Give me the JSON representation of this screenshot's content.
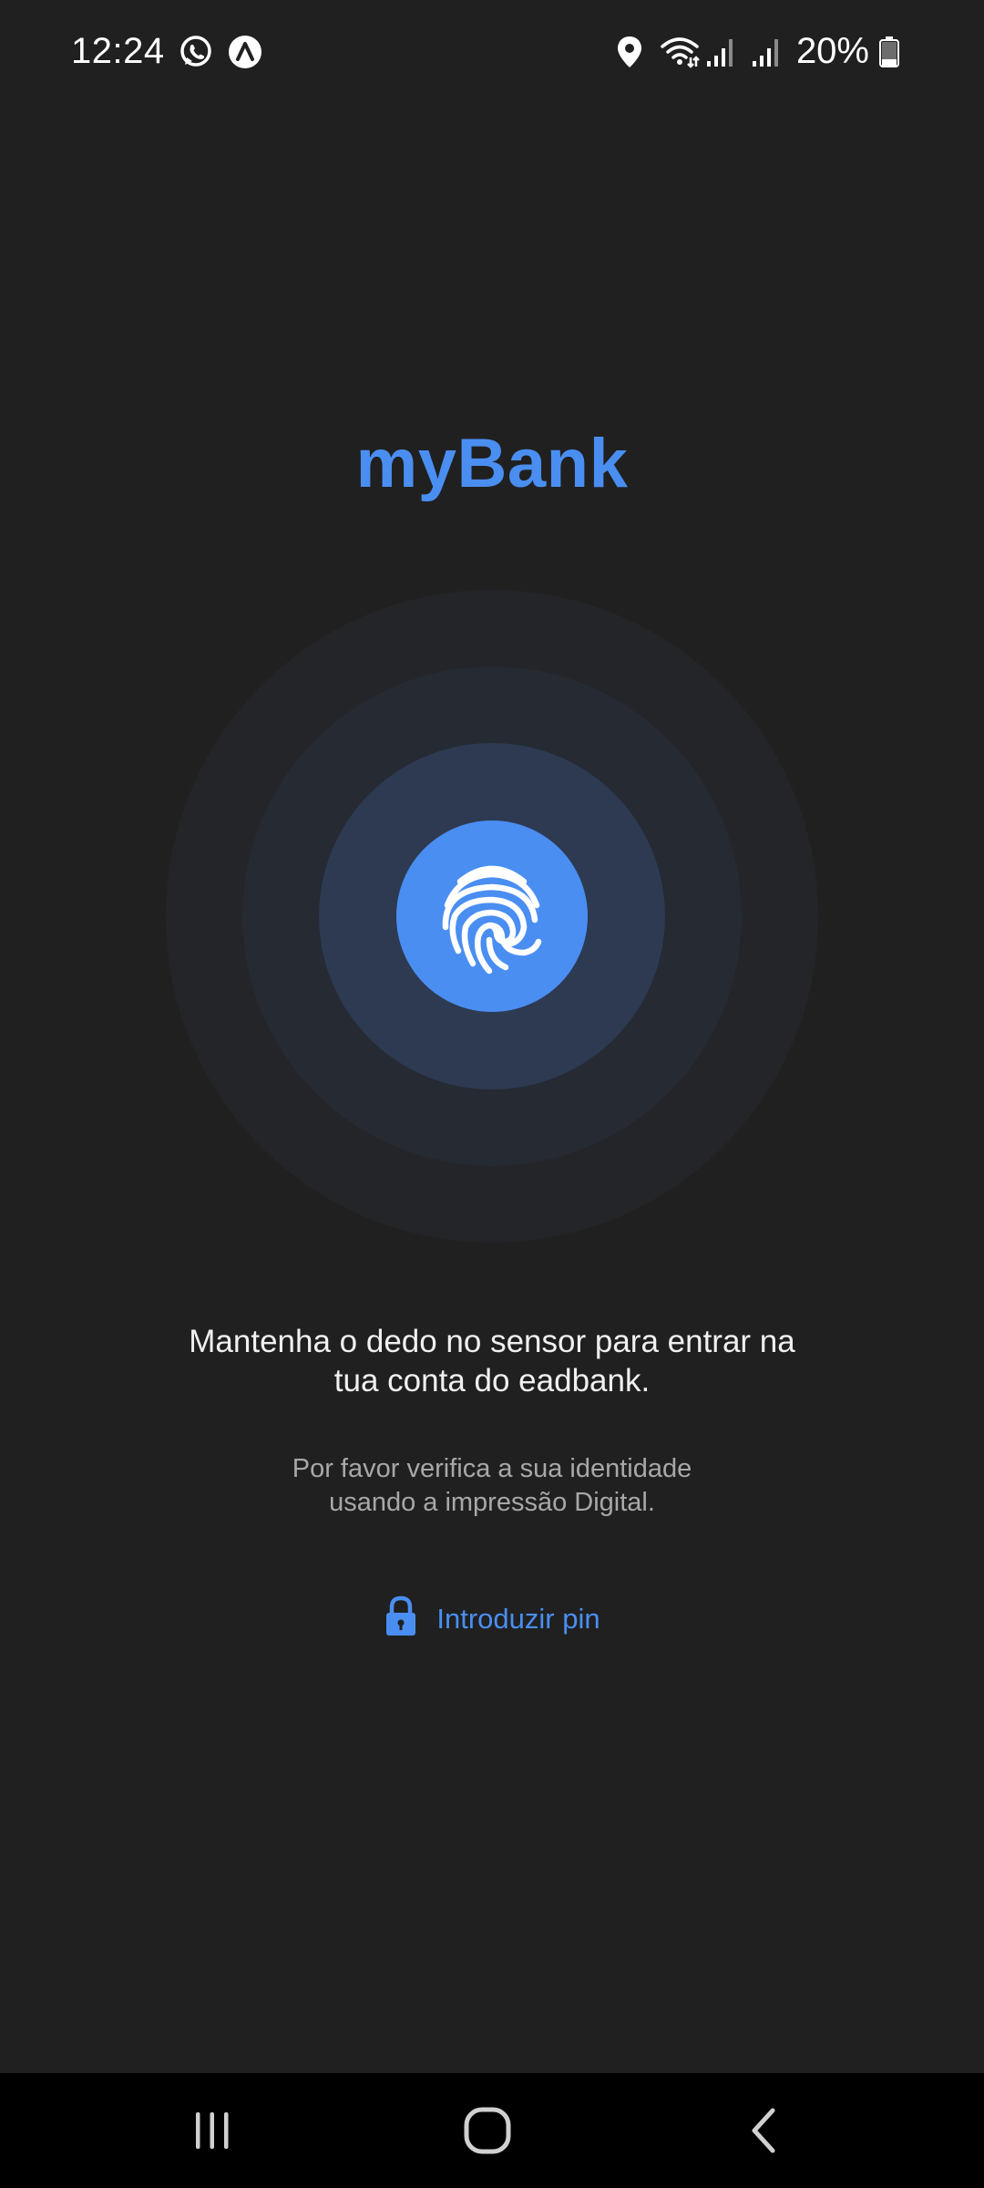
{
  "status_bar": {
    "time": "12:24",
    "battery": "20%",
    "left_icons": [
      "whatsapp-icon",
      "app-notification-icon"
    ],
    "right_icons": [
      "location-icon",
      "wifi-icon",
      "signal-icon",
      "signal-icon",
      "battery-icon"
    ]
  },
  "app": {
    "title": "myBank"
  },
  "fingerprint": {
    "icon": "fingerprint-icon",
    "accent_color": "#4a8ef2"
  },
  "instruction": {
    "line1": "Mantenha o dedo no sensor para entrar na",
    "line2": "tua conta do eadbank."
  },
  "subtitle": {
    "line1": "Por favor verifica a sua identidade",
    "line2": "usando a impressão Digital."
  },
  "pin_link": {
    "icon": "lock-icon",
    "label": "Introduzir pin"
  },
  "nav_bar": {
    "buttons": [
      "recents-button",
      "home-button",
      "back-button"
    ]
  }
}
